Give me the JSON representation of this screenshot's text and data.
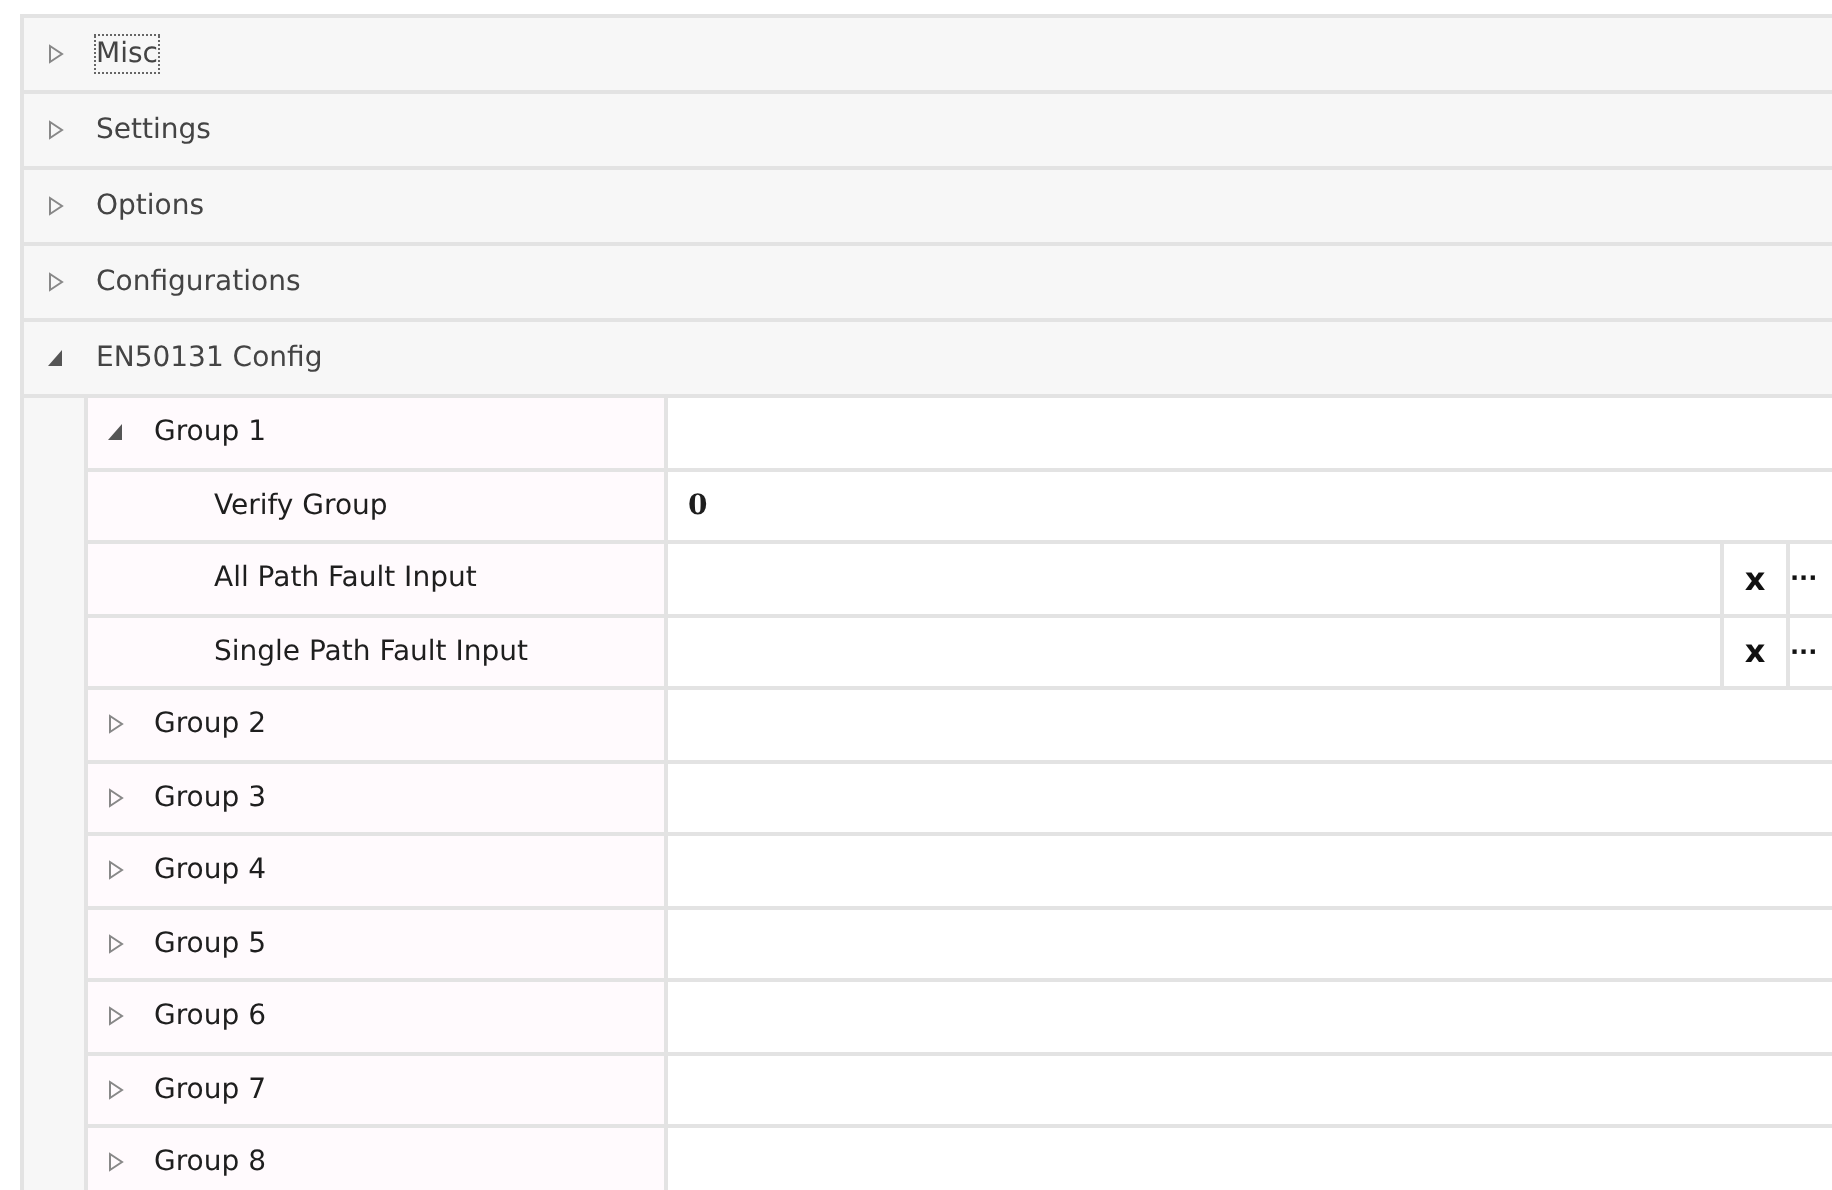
{
  "categories": [
    {
      "label": "Misc",
      "expanded": false,
      "focused": true
    },
    {
      "label": "Settings",
      "expanded": false,
      "focused": false
    },
    {
      "label": "Options",
      "expanded": false,
      "focused": false
    },
    {
      "label": "Configurations",
      "expanded": false,
      "focused": false
    },
    {
      "label": "EN50131 Config",
      "expanded": true,
      "focused": false,
      "children": [
        {
          "label": "Group 1",
          "expanded": true,
          "properties": [
            {
              "name": "Verify Group",
              "kind": "value",
              "value": "0"
            },
            {
              "name": "All Path Fault Input",
              "kind": "editor",
              "buttons": [
                "x",
                "···"
              ]
            },
            {
              "name": "Single Path Fault Input",
              "kind": "editor",
              "buttons": [
                "x",
                "···"
              ]
            }
          ]
        },
        {
          "label": "Group 2",
          "expanded": false
        },
        {
          "label": "Group 3",
          "expanded": false
        },
        {
          "label": "Group 4",
          "expanded": false
        },
        {
          "label": "Group 5",
          "expanded": false
        },
        {
          "label": "Group 6",
          "expanded": false
        },
        {
          "label": "Group 7",
          "expanded": false
        },
        {
          "label": "Group 8",
          "expanded": false
        }
      ]
    }
  ]
}
